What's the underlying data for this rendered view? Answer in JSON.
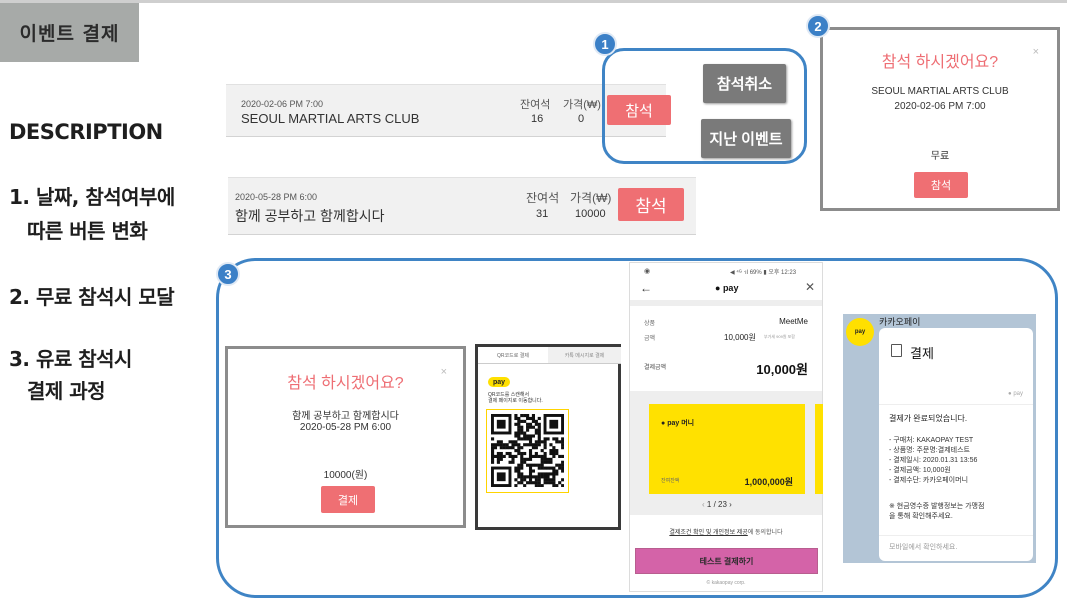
{
  "page": {
    "header_title": "이벤트 결제",
    "description_title": "DESCRIPTION",
    "desc_items": [
      "1. 날짜, 참석여부에",
      "따른 버튼 변화",
      "2. 무료 참석시 모달",
      "3. 유료 참석시",
      "결제 과정"
    ],
    "badges": [
      "1",
      "2",
      "3"
    ]
  },
  "row1": {
    "date": "2020-02-06 PM 7:00",
    "name": "SEOUL MARTIAL ARTS CLUB",
    "seats_header": "잔여석",
    "price_header": "가격(₩)",
    "seats": "16",
    "price": "0",
    "attend_button": "참석",
    "cancel_button": "참석취소",
    "past_button": "지난 이벤트"
  },
  "row2": {
    "date": "2020-05-28 PM 6:00",
    "name": "함께 공부하고 함께합시다",
    "seats_header": "잔여석",
    "price_header": "가격(₩)",
    "seats": "31",
    "price": "10000",
    "attend_button": "참석"
  },
  "modal_free": {
    "title": "참석 하시겠어요?",
    "close": "×",
    "event_name": "SEOUL MARTIAL ARTS CLUB",
    "datetime": "2020-02-06 PM 7:00",
    "price_text": "무료",
    "confirm_button": "참석"
  },
  "modal_paid": {
    "title": "참석 하시겠어요?",
    "close": "×",
    "event_name": "함께 공부하고 함께합시다",
    "datetime": "2020-05-28 PM 6:00",
    "price_text": "10000(원)",
    "confirm_button": "결제"
  },
  "qr_panel": {
    "tab_left": "QR코드로 결제",
    "tab_right": "카톡 메시지로 결제",
    "brand": "pay",
    "instruction_1": "QR코드를 스캔해서",
    "instruction_2": "결제 페이지로 이동합니다."
  },
  "phone": {
    "status_text": "◀ ⁴ᴳ ᐧıl 69% ▮ 오후 12:23",
    "brand": "pay",
    "label_product": "상품",
    "product_value": "MeetMe",
    "label_amount": "금액",
    "amount_value": "10,000원",
    "amount_note": "부가세 909원 포함",
    "label_total": "결제금액",
    "total_value": "10,000원",
    "card_label": "pay 머니",
    "card_balance_label": "잔여잔액",
    "card_balance": "1,000,000원",
    "pager": "1 / 23",
    "terms_link": "결제조건 확인 및 개인정보 제공",
    "terms_suffix": "에 동의합니다",
    "pay_button": "테스트 결제하기",
    "footer": "© kakaopay corp."
  },
  "kakaotalk": {
    "sender": "카카오페이",
    "avatar_text": "pay",
    "card_title": "결제",
    "card_brand": "pay",
    "message_complete": "결제가 완료되었습니다.",
    "details": [
      "- 구매처: KAKAOPAY TEST",
      "- 상품명: 주문명:결제테스트",
      "- 결제일시: 2020.01.31 13:56",
      "- 결제금액: 10,000원",
      "- 결제수단: 카카오페이머니"
    ],
    "notice_1": "※ 현금영수증 발행정보는 가맹점",
    "notice_2": "을 통해 확인해주세요.",
    "footer_link": "모바일에서 확인하세요."
  },
  "colors": {
    "accent_blue": "#3f84c5",
    "pink_button": "#ef6f73",
    "gray_button": "#7a7a7a",
    "kakao_yellow": "#ffe100",
    "pay_button": "#d463a8"
  }
}
